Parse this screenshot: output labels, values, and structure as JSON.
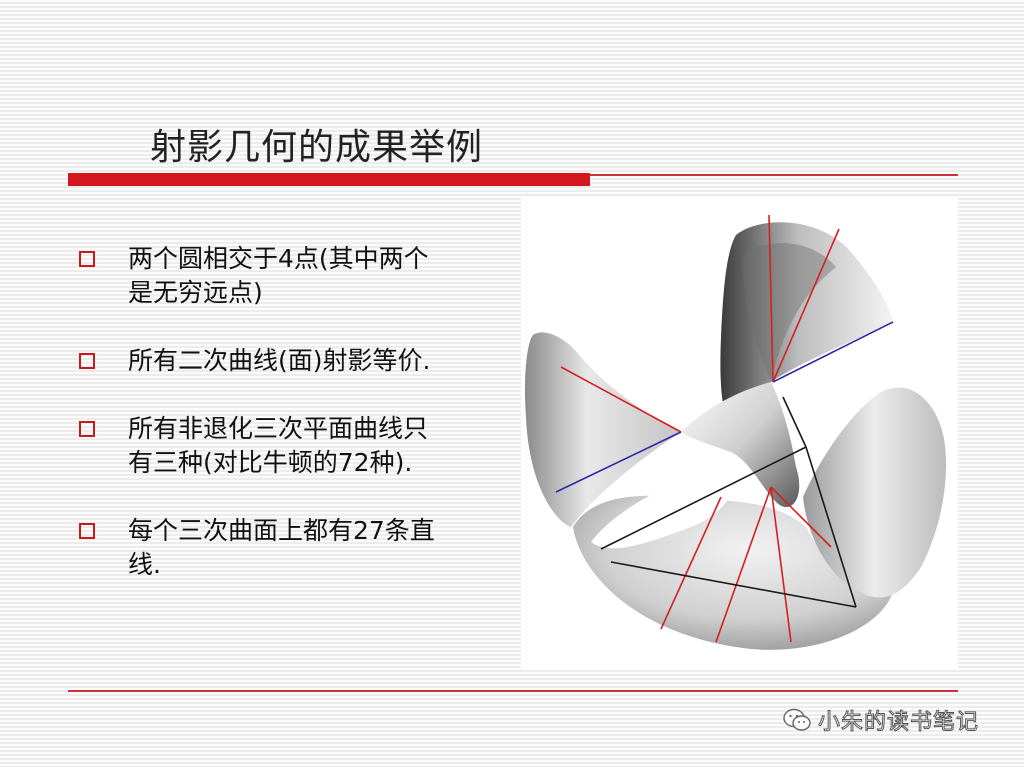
{
  "slide": {
    "title": "射影几何的成果举例",
    "bullets": [
      {
        "line1": "两个圆相交于4点(其中两个",
        "line2": "是无穷远点)"
      },
      {
        "line1": "所有二次曲线(面)射影等价.",
        "line2": ""
      },
      {
        "line1": "所有非退化三次平面曲线只",
        "line2": "有三种(对比牛顿的72种)."
      },
      {
        "line1": "每个三次曲面上都有27条直",
        "line2": "线."
      }
    ]
  },
  "figure": {
    "name": "cubic-surface-with-27-lines",
    "line_colors": {
      "red": "#d42020",
      "blue": "#2a2aa8",
      "black": "#1a1a1a"
    }
  },
  "watermark": {
    "text": "小朱的读书笔记",
    "icon": "wechat-icon"
  },
  "colors": {
    "accent": "#d2171e",
    "bullet": "#c41a20",
    "text": "#111111"
  }
}
